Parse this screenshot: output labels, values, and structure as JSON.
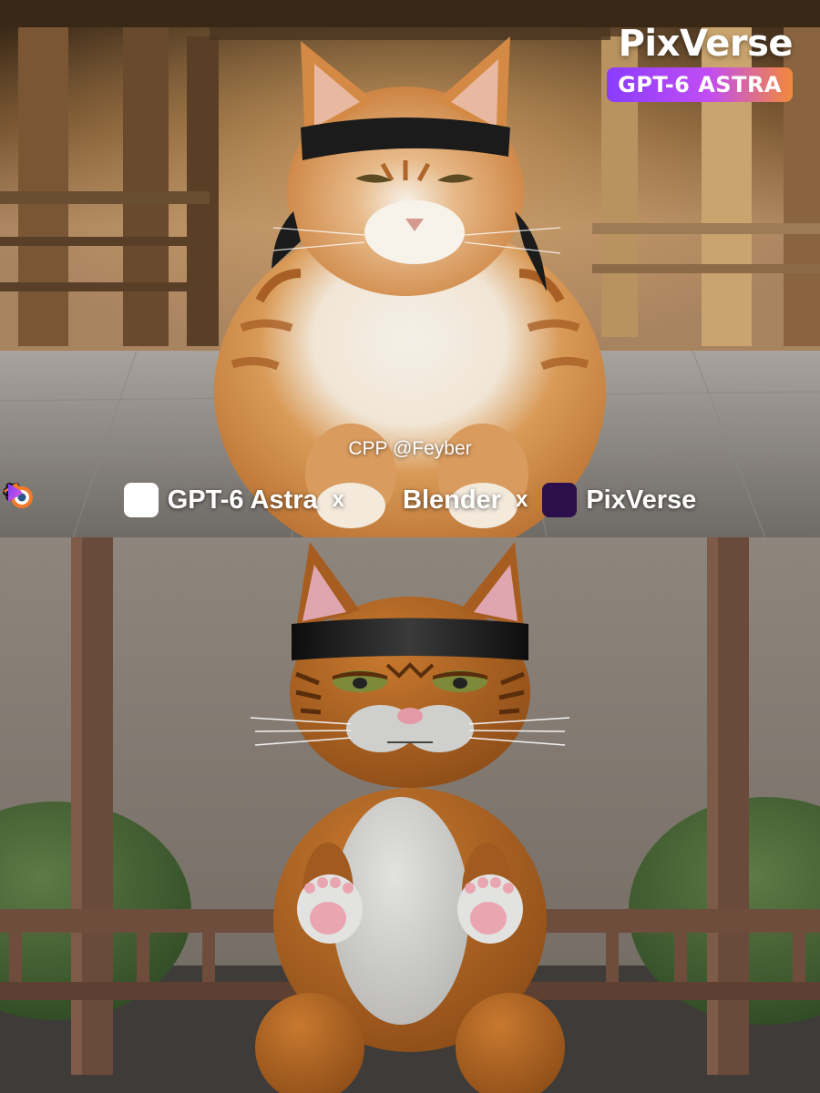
{
  "branding": {
    "name": "PixVerse",
    "badge": "GPT-6 ASTRA"
  },
  "credit": "CPP @Feyber",
  "collaboration": {
    "items": [
      {
        "name": "GPT-6 Astra",
        "icon": "openai-icon"
      },
      {
        "name": "Blender",
        "icon": "blender-icon"
      },
      {
        "name": "PixVerse",
        "icon": "pixverse-icon"
      }
    ],
    "separator": "x"
  },
  "scene": {
    "top": "photo-orange-cat-headband-temple",
    "bottom": "3d-render-orange-cat-headband-railing"
  },
  "colors": {
    "badge_gradient_start": "#8a3cff",
    "badge_gradient_end": "#f38a3a",
    "cat_orange": "#c77a35",
    "headband": "#1c1c1c"
  }
}
